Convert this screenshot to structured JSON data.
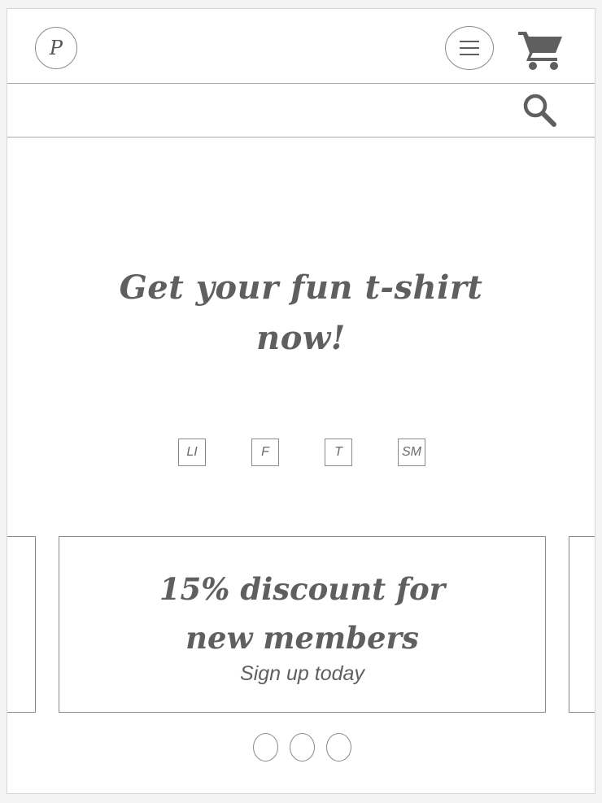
{
  "header": {
    "logo_text": "P",
    "logo_icon": "logo-p-icon",
    "menu_icon": "hamburger-menu-icon",
    "cart_icon": "shopping-cart-icon"
  },
  "search": {
    "placeholder": "",
    "icon": "search-icon"
  },
  "hero": {
    "title_line1": "Get your fun t-shirt",
    "title_line2": "now!"
  },
  "social": [
    "LI",
    "F",
    "T",
    "SM"
  ],
  "promo": {
    "title_line1": "15% discount for",
    "title_line2": "new members",
    "subtitle": "Sign up today"
  },
  "carousel": {
    "dot_count": 3
  },
  "colors": {
    "text": "#5f5f5f",
    "border": "#8a8a8a",
    "icon": "#5f5f5f"
  }
}
